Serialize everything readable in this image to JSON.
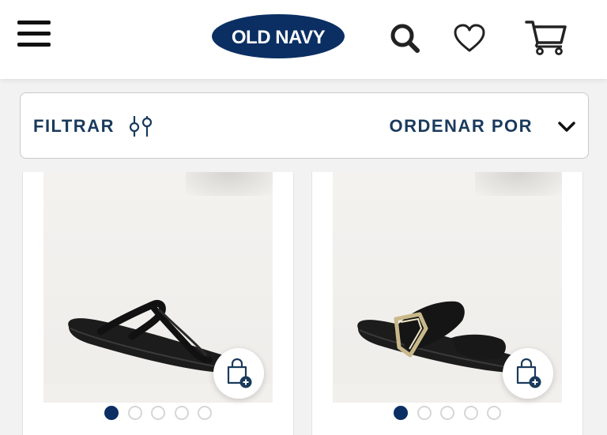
{
  "header": {
    "logo_text": "OLD NAVY",
    "menu_icon": "hamburger-menu-icon",
    "search_icon": "search-icon",
    "wishlist_icon": "heart-icon",
    "cart_icon": "cart-icon"
  },
  "filters": {
    "filter_label": "FILTRAR",
    "filter_icon": "sliders-icon",
    "sort_label": "ORDENAR POR",
    "sort_icon": "chevron-down-icon"
  },
  "products": [
    {
      "image": "black-thong-sandal",
      "swatch_count": 5,
      "active_swatch": 1,
      "add_icon": "shopping-bag-plus-icon"
    },
    {
      "image": "black-buckle-slide-sandal",
      "swatch_count": 5,
      "active_swatch": 1,
      "add_icon": "shopping-bag-plus-icon"
    }
  ],
  "colors": {
    "brand_navy": "#0b2f63",
    "text_navy": "#1a3a5c"
  }
}
